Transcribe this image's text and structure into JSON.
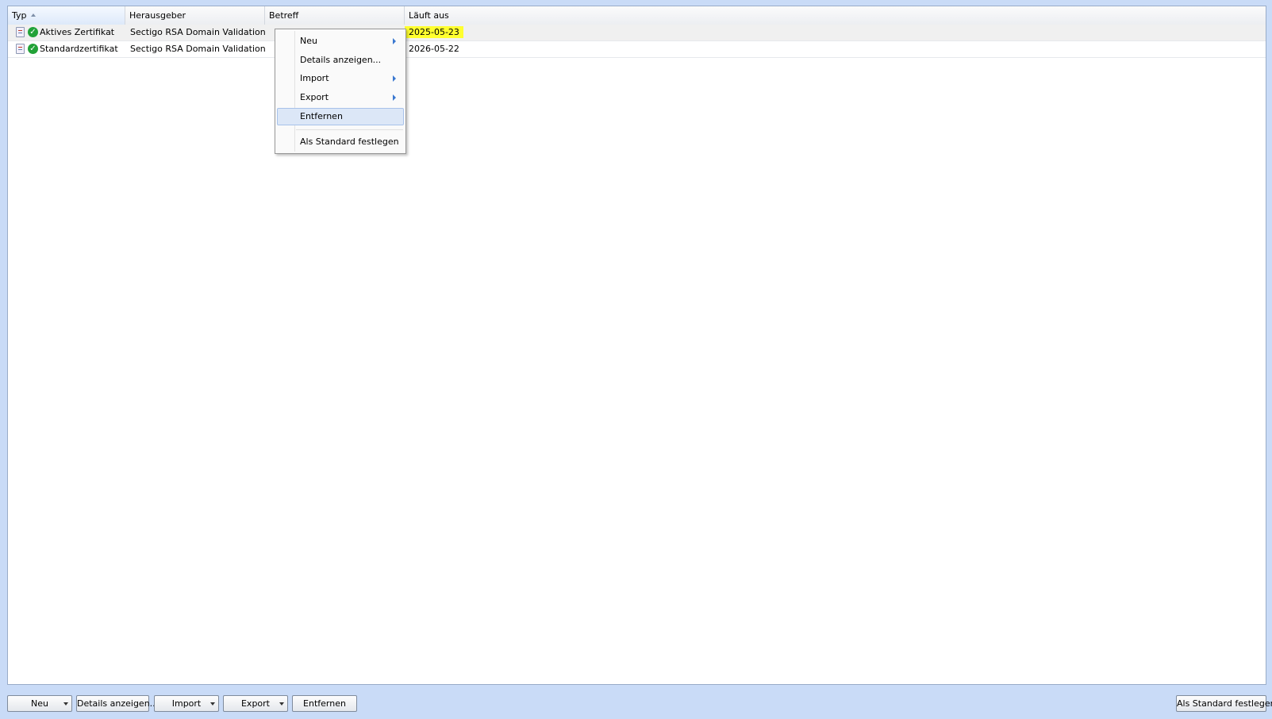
{
  "table": {
    "columns": [
      "Typ",
      "Herausgeber",
      "Betreff",
      "Läuft aus"
    ],
    "rows": [
      {
        "typ": "Aktives Zertifikat",
        "herausgeber": "Sectigo RSA Domain Validation Se...",
        "betreff": "",
        "expires": "2025-05-23"
      },
      {
        "typ": "Standardzertifikat",
        "herausgeber": "Sectigo RSA Domain Validation Se...",
        "betreff": "",
        "expires": "2026-05-22"
      }
    ]
  },
  "context_menu": {
    "items": [
      "Neu",
      "Details anzeigen...",
      "Import",
      "Export",
      "Entfernen",
      "Als Standard festlegen"
    ]
  },
  "toolbar": {
    "new": "Neu",
    "details": "Details anzeigen...",
    "import": "Import",
    "export": "Export",
    "remove": "Entfernen",
    "set_default": "Als Standard festlegen"
  },
  "colors": {
    "background": "#c9dbf7",
    "highlight": "#ffff2e",
    "status_ok": "#22a238",
    "menu_hover": "#dce7f7"
  }
}
